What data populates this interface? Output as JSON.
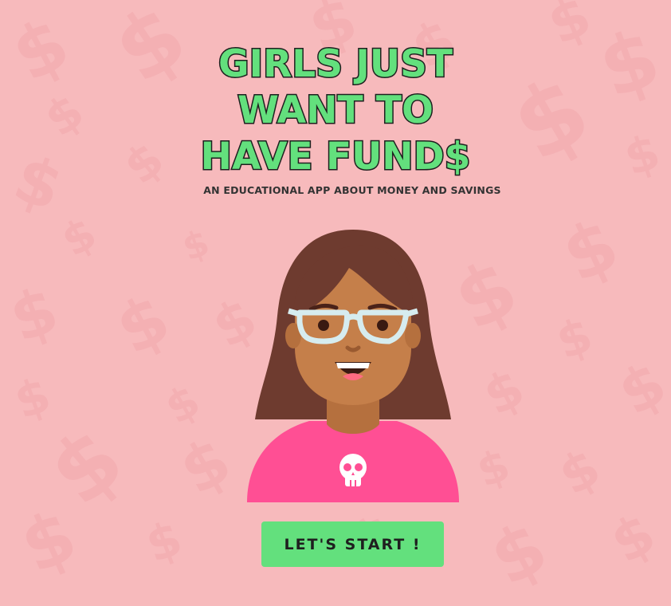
{
  "app": {
    "title_lines": [
      "GIRLS JUST",
      "WANT TO",
      "HAVE FUND$"
    ],
    "subtitle": "AN EDUCATIONAL APP ABOUT MONEY AND SAVINGS"
  },
  "actions": {
    "start_label": "LET'S START !"
  },
  "colors": {
    "background": "#f7babc",
    "pattern": "#f2a8ad",
    "title_fill": "#63e07d",
    "title_outline": "#1f1f1f",
    "button": "#63e07d",
    "shirt": "#ff4f94",
    "hair": "#6e3b2f",
    "skin": "#c57f4a",
    "glasses": "#d6ecef"
  },
  "icons": {
    "background_pattern": "dollar-sign-icon",
    "shirt_emblem": "skull-icon"
  }
}
